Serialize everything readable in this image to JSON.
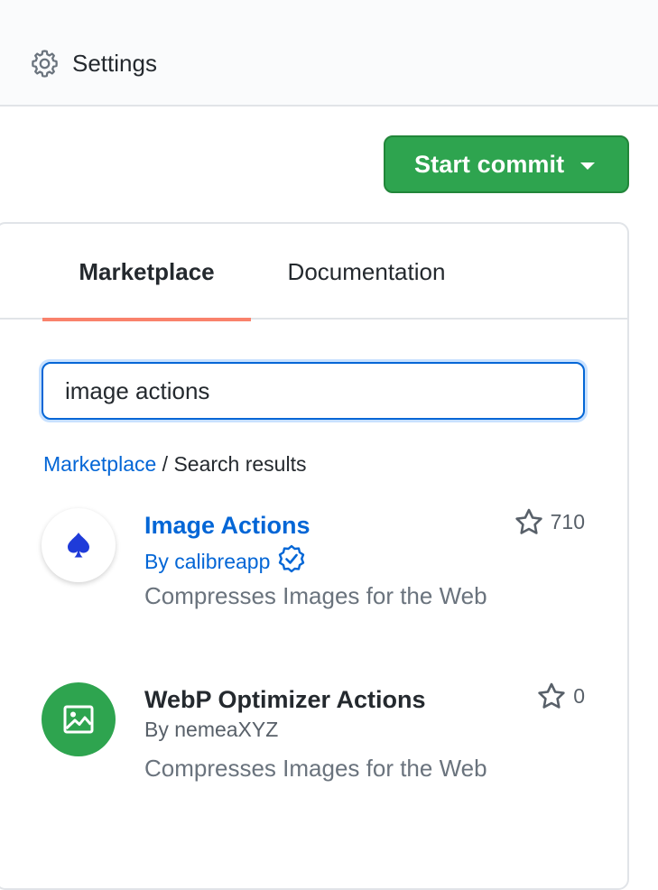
{
  "header": {
    "settings_label": "Settings"
  },
  "toolbar": {
    "start_commit_label": "Start commit"
  },
  "tabs": [
    {
      "label": "Marketplace",
      "selected": true
    },
    {
      "label": "Documentation",
      "selected": false
    }
  ],
  "search": {
    "value": "image actions"
  },
  "breadcrumb": {
    "root": "Marketplace",
    "separator": "/",
    "current": "Search results"
  },
  "results": [
    {
      "title": "Image Actions",
      "by": "By calibreapp",
      "verified": true,
      "description": "Compresses Images for the Web",
      "stars": "710",
      "icon": "spade-icon"
    },
    {
      "title": "WebP Optimizer Actions",
      "by": "By nemeaXYZ",
      "verified": false,
      "description": "Compresses Images for the Web",
      "stars": "0",
      "icon": "image-icon"
    }
  ],
  "colors": {
    "accent_blue": "#0366d6",
    "commit_green": "#2ea44f",
    "tab_underline": "#f9826c"
  }
}
